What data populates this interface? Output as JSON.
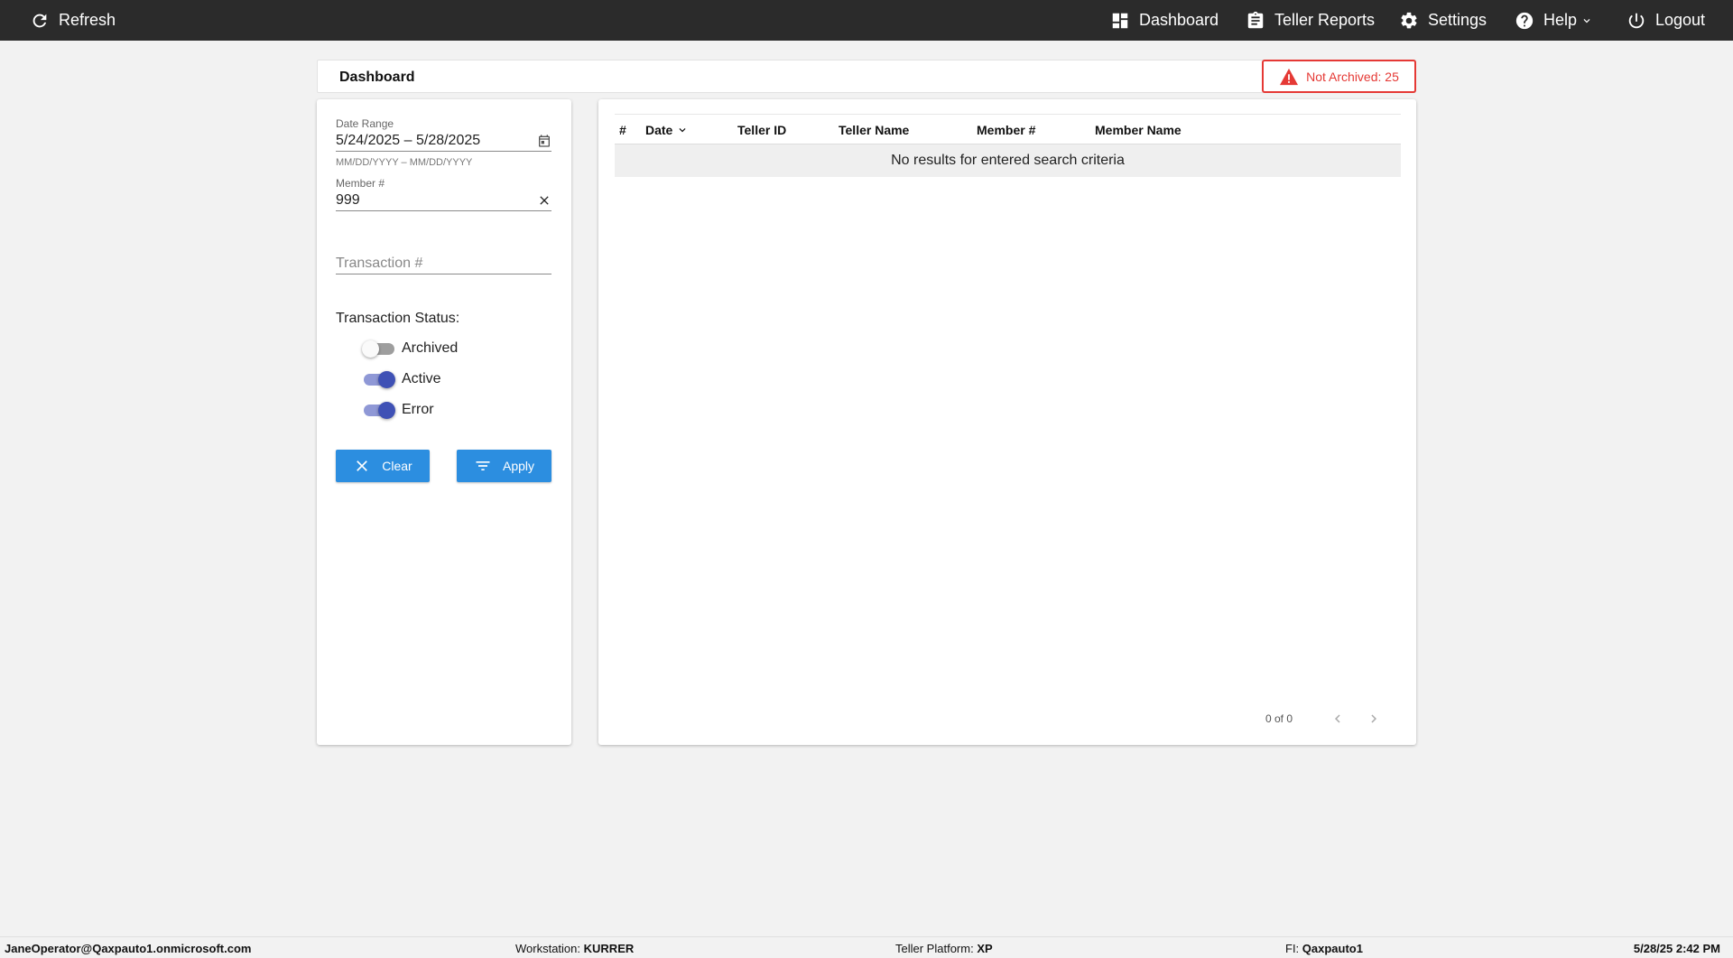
{
  "topbar": {
    "refresh": "Refresh",
    "dashboard": "Dashboard",
    "teller_reports": "Teller Reports",
    "settings": "Settings",
    "help": "Help",
    "logout": "Logout"
  },
  "header": {
    "title": "Dashboard",
    "not_archived": "Not Archived: 25"
  },
  "filters": {
    "date_range_label": "Date Range",
    "date_range_value": "5/24/2025 – 5/28/2025",
    "date_range_hint": "MM/DD/YYYY – MM/DD/YYYY",
    "member_label": "Member #",
    "member_value": "999",
    "transaction_placeholder": "Transaction #",
    "status_label": "Transaction Status:",
    "toggles": [
      {
        "label": "Archived",
        "on": false
      },
      {
        "label": "Active",
        "on": true
      },
      {
        "label": "Error",
        "on": true
      }
    ],
    "clear_label": "Clear",
    "apply_label": "Apply"
  },
  "table": {
    "columns": [
      "#",
      "Date",
      "Teller ID",
      "Teller Name",
      "Member #",
      "Member Name"
    ],
    "empty_message": "No results for entered search criteria",
    "pager_text": "0 of 0"
  },
  "footer": {
    "user": "JaneOperator@Qaxpauto1.onmicrosoft.com",
    "workstation_label": "Workstation:",
    "workstation_value": "KURRER",
    "platform_label": "Teller Platform:",
    "platform_value": "XP",
    "fi_label": "FI:",
    "fi_value": "Qaxpauto1",
    "datetime": "5/28/25 2:42 PM"
  },
  "colors": {
    "topbar": "#2b2b2b",
    "accent_button": "#2c8ee0",
    "toggle_on": "#3f51b5",
    "alert": "#e53935"
  }
}
